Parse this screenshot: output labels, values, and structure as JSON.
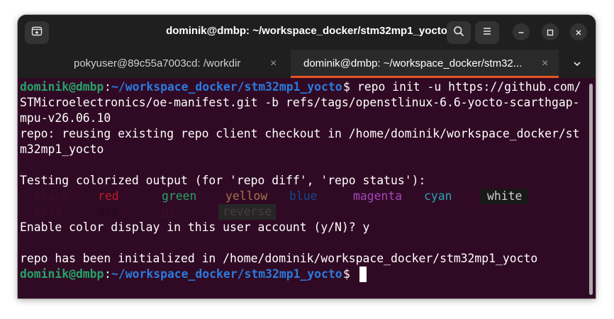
{
  "window": {
    "title": "dominik@dmbp: ~/workspace_docker/stm32mp1_yocto"
  },
  "tabs": [
    {
      "label": "pokyuser@89c55a7003cd: /workdir",
      "close": "×",
      "active": false
    },
    {
      "label": "dominik@dmbp: ~/workspace_docker/stm32...",
      "close": "×",
      "active": true
    }
  ],
  "icons": {
    "new_tab": "new-tab-icon",
    "search": "search-icon",
    "menu": "hamburger-menu-icon",
    "minimize": "minimize-icon",
    "maximize": "maximize-icon",
    "close": "close-icon",
    "tabs_dropdown": "chevron-down-icon"
  },
  "colors": {
    "terminal_bg": "#300a24",
    "prompt_user": "#26a269",
    "prompt_path": "#2a7bde",
    "accent": "#e95420",
    "headerbar": "#1f1f1f"
  },
  "terminal": {
    "prompt_user": "dominik@dmbp",
    "prompt_sep": ":",
    "prompt_path": "~/workspace_docker/stm32mp1_yocto",
    "prompt_symbol": "$",
    "command_line1": " repo init -u https://github.com/",
    "line2": "STMicroelectronics/oe-manifest.git -b refs/tags/openstlinux-6.6-yocto-scarthgap-",
    "line3": "mpu-v26.06.10",
    "line4": "repo: reusing existing repo client checkout in /home/dominik/workspace_docker/st",
    "line5": "m32mp1_yocto",
    "line6": "Testing colorized output (for 'repo diff', 'repo status'):",
    "colors_row1": [
      {
        "text": "black",
        "color": "#3a0e2c",
        "bg": ""
      },
      {
        "text": "red",
        "color": "#c01c28",
        "bg": ""
      },
      {
        "text": "green",
        "color": "#26a269",
        "bg": ""
      },
      {
        "text": "yellow",
        "color": "#a2734c",
        "bg": ""
      },
      {
        "text": "blue",
        "color": "#12488b",
        "bg": ""
      },
      {
        "text": "magenta",
        "color": "#a347ba",
        "bg": ""
      },
      {
        "text": "cyan",
        "color": "#2aa1b3",
        "bg": ""
      },
      {
        "text": "white",
        "color": "#d0cfcc",
        "bg": "#181818"
      }
    ],
    "colors_row2": [
      {
        "text": "bold",
        "color": "#3a0e2c",
        "bg": ""
      },
      {
        "text": "dim",
        "color": "#220818",
        "bg": ""
      },
      {
        "text": "ul",
        "color": "#3a0e2c",
        "bg": ""
      },
      {
        "text": "reverse",
        "color": "#4a3a44",
        "bg": "#262626"
      }
    ],
    "line8": "Enable color display in this user account (y/N)? y",
    "line10": "repo has been initialized in /home/dominik/workspace_docker/stm32mp1_yocto"
  }
}
